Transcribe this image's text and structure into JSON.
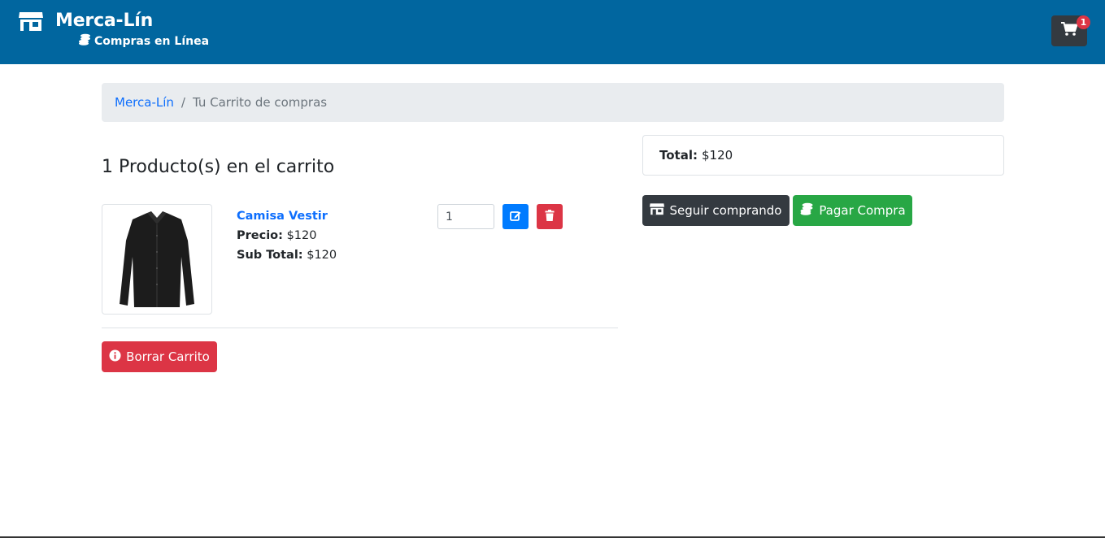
{
  "navbar": {
    "brand_title": "Merca-Lín",
    "brand_subtitle": "Compras en Línea",
    "cart_count": "1",
    "store_icon": "store-icon",
    "coins_icon": "coins-icon",
    "cart_icon": "shopping-cart-icon",
    "color": "#01669f"
  },
  "breadcrumb": {
    "home": "Merca-Lín",
    "separator": "/",
    "current": "Tu Carrito de compras"
  },
  "cart": {
    "title": "1 Producto(s) en el carrito",
    "items": [
      {
        "name": "Camisa Vestir",
        "price_label": "Precio:",
        "price": "$120",
        "subtotal_label": "Sub Total:",
        "subtotal": "$120",
        "quantity": "1",
        "image_icon": "shirt-image"
      }
    ],
    "clear_label": "Borrar Carrito"
  },
  "summary": {
    "total_label": "Total:",
    "total_value": "$120",
    "continue_label": "Seguir comprando",
    "pay_label": "Pagar Compra"
  }
}
